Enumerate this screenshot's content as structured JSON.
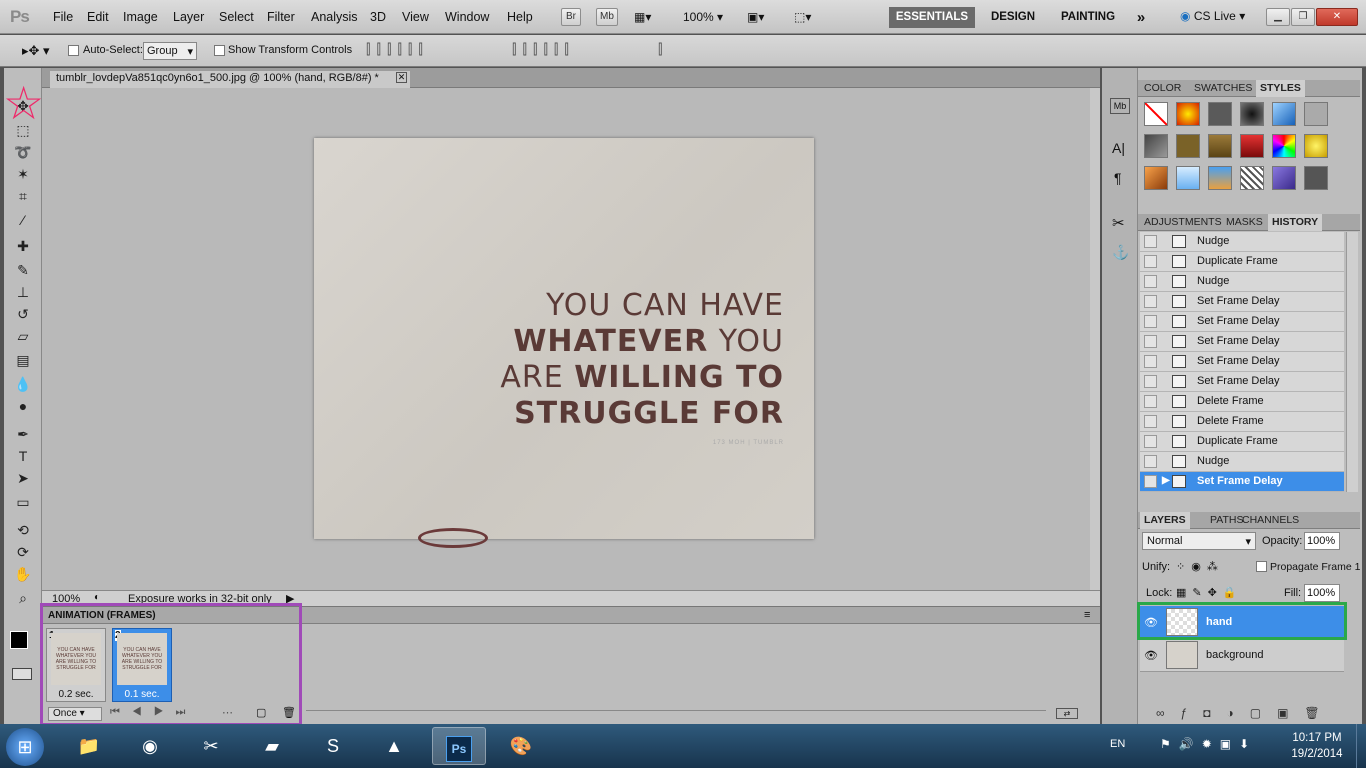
{
  "app": {
    "logo": "Ps"
  },
  "menu": [
    "File",
    "Edit",
    "Image",
    "Layer",
    "Select",
    "Filter",
    "Analysis",
    "3D",
    "View",
    "Window",
    "Help"
  ],
  "appbar": {
    "br": "Br",
    "mb": "Mb",
    "zoom": "100%"
  },
  "workspaces": {
    "essentials": "ESSENTIALS",
    "design": "DESIGN",
    "painting": "PAINTING",
    "more": "»",
    "cslive": "CS Live"
  },
  "options": {
    "autoselect_label": "Auto-Select:",
    "autoselect_value": "Group",
    "transform_label": "Show Transform Controls"
  },
  "document": {
    "tab_title": "tumblr_lovdepVa851qc0yn6o1_500.jpg @ 100% (hand, RGB/8#) *",
    "quote": {
      "line1": "YOU CAN HAVE",
      "line2a": "WHATEVER",
      "line2b": " YOU",
      "line3a": "ARE ",
      "line3b": "WILLING TO",
      "line4": "STRUGGLE FOR",
      "credit": "173 MOH | TUMBLR"
    },
    "status_zoom": "100%",
    "status_text": "Exposure works in 32-bit only"
  },
  "animation": {
    "title": "ANIMATION (FRAMES)",
    "loop": "Once",
    "frames": [
      {
        "num": "1",
        "delay": "0.2 sec."
      },
      {
        "num": "2",
        "delay": "0.1 sec."
      }
    ],
    "thumb_text": "YOU CAN HAVE WHATEVER YOU ARE WILLING TO STRUGGLE FOR"
  },
  "panels": {
    "top_tabs": [
      "COLOR",
      "SWATCHES",
      "STYLES"
    ],
    "mid_tabs": [
      "ADJUSTMENTS",
      "MASKS",
      "HISTORY"
    ],
    "history": [
      "Nudge",
      "Duplicate Frame",
      "Nudge",
      "Set Frame Delay",
      "Set Frame Delay",
      "Set Frame Delay",
      "Set Frame Delay",
      "Set Frame Delay",
      "Delete Frame",
      "Delete Frame",
      "Duplicate Frame",
      "Nudge",
      "Set Frame Delay"
    ],
    "layer_tabs": [
      "LAYERS",
      "PATHS",
      "CHANNELS"
    ],
    "blend_mode": "Normal",
    "opacity_label": "Opacity:",
    "opacity": "100%",
    "unify_label": "Unify:",
    "propagate_label": "Propagate Frame 1",
    "lock_label": "Lock:",
    "fill_label": "Fill:",
    "fill": "100%",
    "layers": [
      {
        "name": "hand",
        "selected": true
      },
      {
        "name": "background",
        "selected": false
      }
    ]
  },
  "tray": {
    "lang": "EN",
    "time": "10:17 PM",
    "date": "19/2/2014"
  },
  "colors": {
    "highlight_blue": "#3d8ee8",
    "purple_box": "#a04ab8",
    "green_box": "#2aa84a",
    "star_pink": "#ee2a6a"
  }
}
